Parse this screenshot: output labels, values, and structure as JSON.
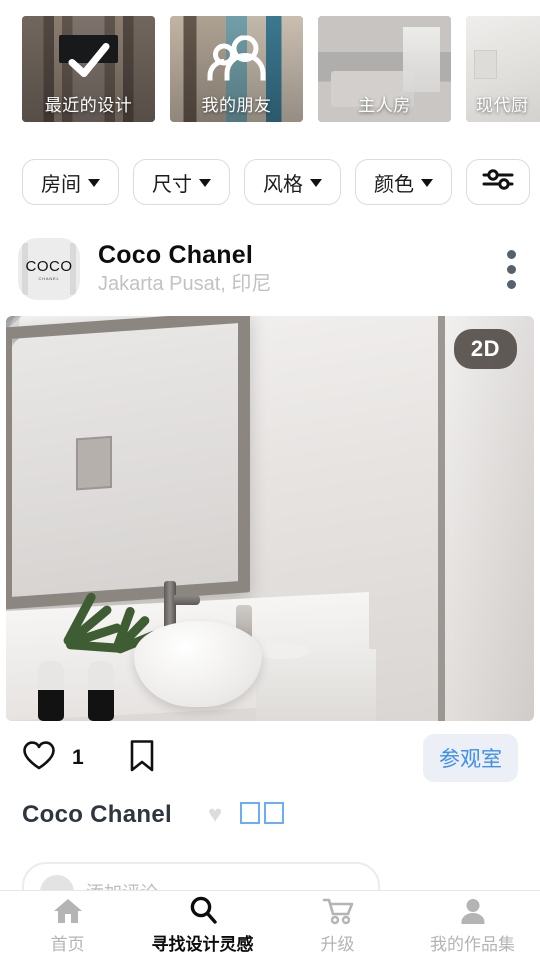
{
  "categories": [
    {
      "label": "最近的设计",
      "icon": "check-icon",
      "selected": true
    },
    {
      "label": "我的朋友",
      "icon": "people-group-icon",
      "selected": false
    },
    {
      "label": "主人房",
      "icon": "",
      "selected": false
    },
    {
      "label": "现代厨",
      "icon": "",
      "selected": false
    }
  ],
  "filters": {
    "chips": [
      {
        "label": "房间"
      },
      {
        "label": "尺寸"
      },
      {
        "label": "风格"
      },
      {
        "label": "颜色"
      }
    ],
    "tune_icon": "sliders-icon"
  },
  "post": {
    "author": {
      "name": "Coco Chanel",
      "location": "Jakarta Pusat, 印尼",
      "avatar_text": "COCO",
      "avatar_subtext": "CHANEL"
    },
    "menu_icon": "kebab-menu-icon",
    "image": {
      "badge": "2D",
      "alt": "marble bathroom render"
    },
    "actions": {
      "like_icon": "heart-outline-icon",
      "like_count": "1",
      "bookmark_icon": "bookmark-outline-icon",
      "visit_label": "参观室"
    },
    "caption": {
      "text": "Coco Chanel",
      "heart_emoji": "♥",
      "tofu_count": 2
    }
  },
  "comment": {
    "placeholder": "添加评论"
  },
  "bottom_nav": [
    {
      "label": "首页",
      "icon": "home-icon",
      "active": false
    },
    {
      "label": "寻找设计灵感",
      "icon": "search-icon",
      "active": true
    },
    {
      "label": "升级",
      "icon": "cart-icon",
      "active": false
    },
    {
      "label": "我的作品集",
      "icon": "person-icon",
      "active": false
    }
  ],
  "colors": {
    "accent_blue": "#3b8ff0",
    "visit_bg": "#eceff5",
    "tofu_border": "#6aaef5",
    "muted": "#c2c2c2",
    "nav_inactive": "#b4b4b4"
  }
}
